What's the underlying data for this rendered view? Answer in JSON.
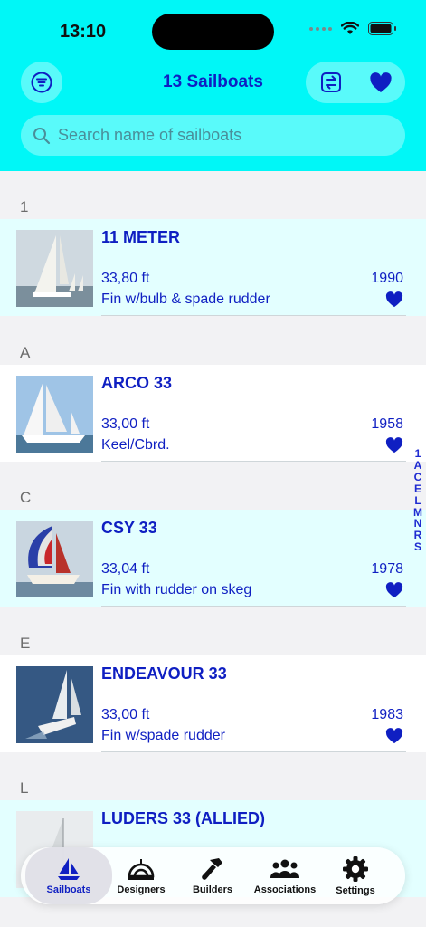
{
  "status": {
    "time": "13:10"
  },
  "header": {
    "title": "13 Sailboats",
    "search_placeholder": "Search name of sailboats"
  },
  "sections": [
    {
      "letter": "1",
      "rows": [
        {
          "name": "11 METER",
          "length": "33,80 ft",
          "year": "1990",
          "keel": "Fin w/bulb & spade rudder"
        }
      ]
    },
    {
      "letter": "A",
      "rows": [
        {
          "name": "ARCO 33",
          "length": "33,00 ft",
          "year": "1958",
          "keel": "Keel/Cbrd."
        }
      ]
    },
    {
      "letter": "C",
      "rows": [
        {
          "name": "CSY 33",
          "length": "33,04 ft",
          "year": "1978",
          "keel": "Fin with rudder on skeg"
        }
      ]
    },
    {
      "letter": "E",
      "rows": [
        {
          "name": "ENDEAVOUR 33",
          "length": "33,00 ft",
          "year": "1983",
          "keel": "Fin w/spade rudder"
        }
      ]
    },
    {
      "letter": "L",
      "rows": [
        {
          "name": "LUDERS 33 (ALLIED)",
          "length": "",
          "year": "",
          "keel": ""
        }
      ]
    }
  ],
  "index_letters": [
    "1",
    "A",
    "C",
    "E",
    "L",
    "M",
    "N",
    "R",
    "S"
  ],
  "tabs": [
    {
      "label": "Sailboats",
      "icon": "sailboat-icon",
      "active": true
    },
    {
      "label": "Designers",
      "icon": "ruler-icon"
    },
    {
      "label": "Builders",
      "icon": "hammer-icon"
    },
    {
      "label": "Associations",
      "icon": "people-icon"
    },
    {
      "label": "Settings",
      "icon": "gear-icon"
    }
  ],
  "colors": {
    "accent": "#0f1fc2",
    "header": "#00f7f7",
    "row_alt": "#e3ffff"
  }
}
